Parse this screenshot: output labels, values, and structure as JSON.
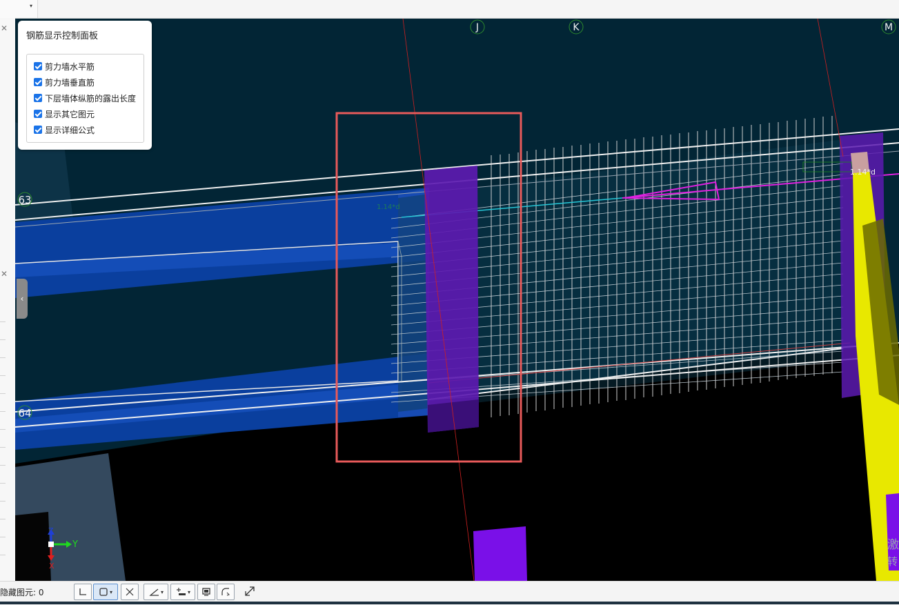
{
  "panel": {
    "title": "钢筋显示控制面板",
    "options": [
      {
        "label": "剪力墙水平筋",
        "checked": true
      },
      {
        "label": "剪力墙垂直筋",
        "checked": true
      },
      {
        "label": "下层墙体纵筋的露出长度",
        "checked": true
      },
      {
        "label": "显示其它图元",
        "checked": true
      },
      {
        "label": "显示详细公式",
        "checked": true
      }
    ]
  },
  "grid_axes": {
    "top": [
      "J",
      "K",
      "M"
    ],
    "left": [
      "63",
      "64"
    ]
  },
  "annotations": {
    "rebar_formula": "1.14*d",
    "side_text_1": "激",
    "side_text_2": "转"
  },
  "axis_gizmo": {
    "y": "Y",
    "z": "Z",
    "x": "X"
  },
  "statusbar": {
    "hidden_elements_label": "隐藏图元:",
    "hidden_elements_count": "0"
  },
  "colors": {
    "viewport_bg": "#022535",
    "wall_blue": "#0a3f9e",
    "column_purple": "#5c1ab0",
    "highlight_red": "#e85a5a",
    "yellow_beam": "#e8e800"
  }
}
